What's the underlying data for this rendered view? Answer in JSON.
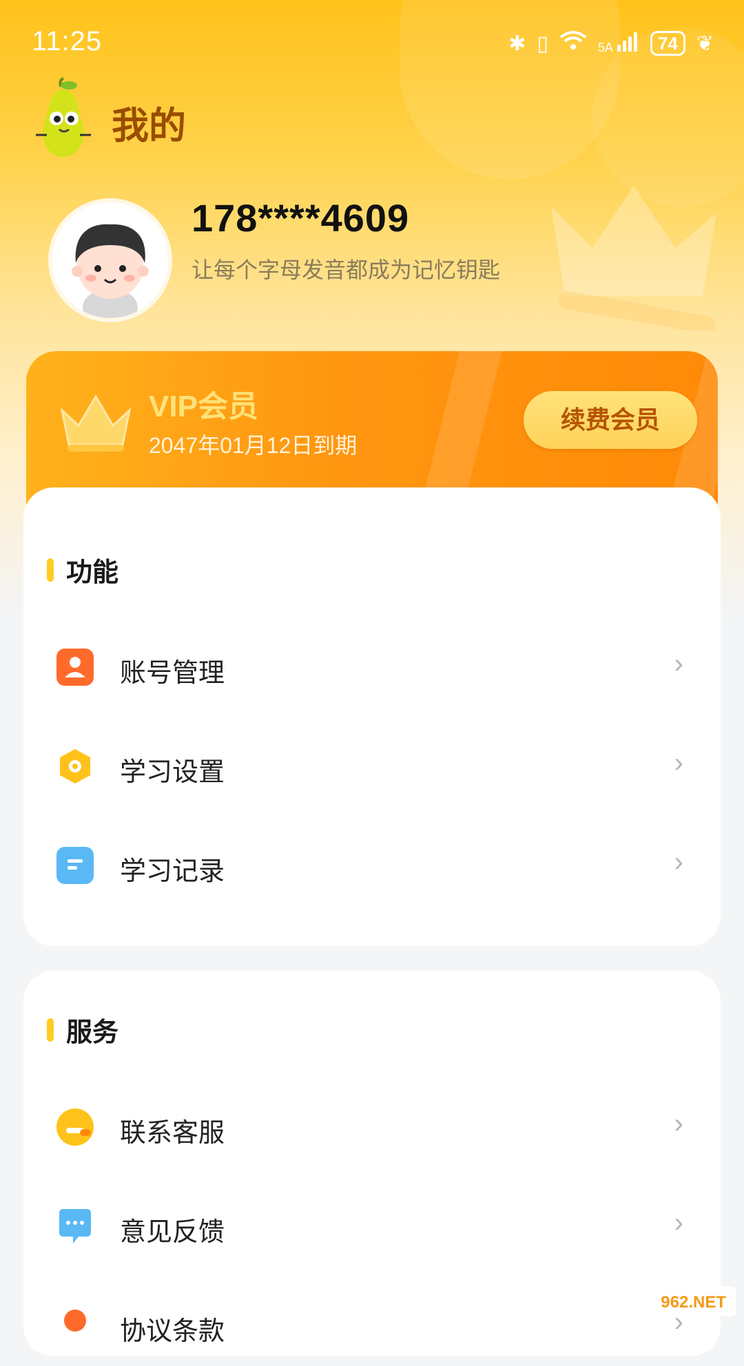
{
  "status_bar": {
    "time": "11:25",
    "network": "5A",
    "battery": "74"
  },
  "header": {
    "title": "我的"
  },
  "profile": {
    "phone": "178****4609",
    "slogan": "让每个字母发音都成为记忆钥匙"
  },
  "vip": {
    "title": "VIP会员",
    "expire": "2047年01月12日到期",
    "renew_label": "续费会员"
  },
  "function_section": {
    "title": "功能",
    "items": [
      {
        "label": "账号管理",
        "icon": "account-icon",
        "color": "#ff6a2b"
      },
      {
        "label": "学习设置",
        "icon": "settings-icon",
        "color": "#ffc21a"
      },
      {
        "label": "学习记录",
        "icon": "record-icon",
        "color": "#5ab8f5"
      }
    ]
  },
  "service_section": {
    "title": "服务",
    "items": [
      {
        "label": "联系客服",
        "icon": "customer-service-icon",
        "color": "#ffc21a"
      },
      {
        "label": "意见反馈",
        "icon": "feedback-icon",
        "color": "#5ab8f5"
      },
      {
        "label": "协议条款",
        "icon": "terms-icon",
        "color": "#ff6a2b"
      }
    ]
  },
  "watermark": {
    "text": "962.NET"
  },
  "colors": {
    "accent": "#ffc21a",
    "vip_orange": "#ff9610",
    "title_brown": "#9a4d00"
  }
}
